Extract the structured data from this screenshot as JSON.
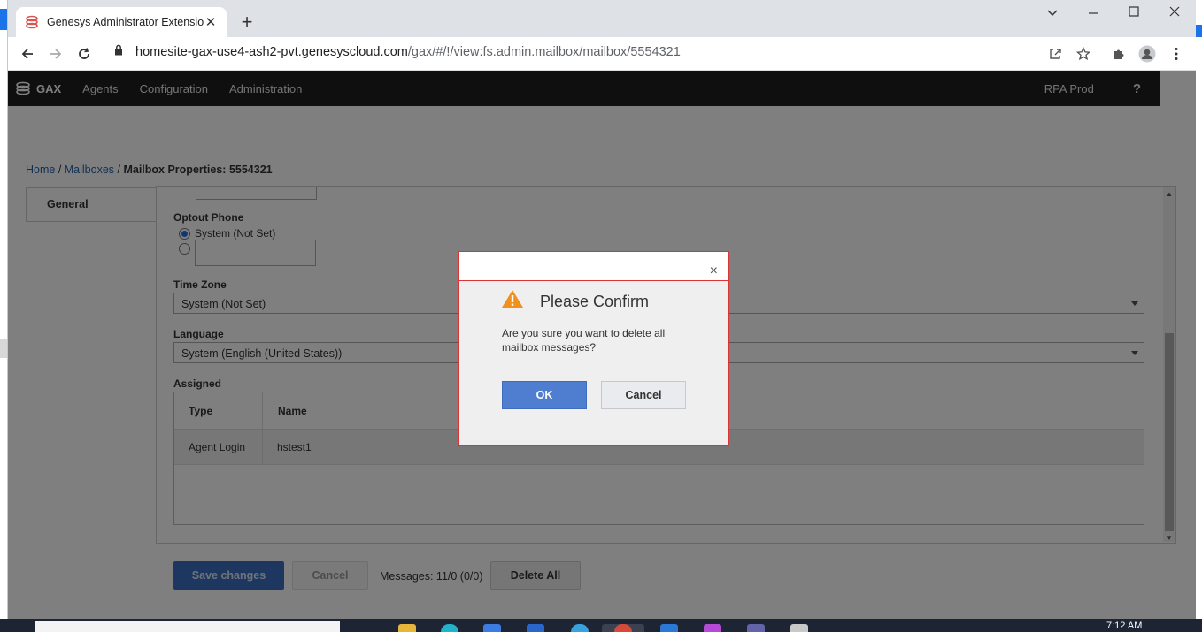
{
  "browser": {
    "tab_title": "Genesys Administrator Extension",
    "url_host": "homesite-gax-use4-ash2-pvt.genesyscloud.com",
    "url_path": "/gax/#/!/view:fs.admin.mailbox/mailbox/5554321"
  },
  "appnav": {
    "brand": "GAX",
    "items": [
      "Agents",
      "Configuration",
      "Administration"
    ],
    "environment": "RPA Prod",
    "help": "?"
  },
  "breadcrumb": {
    "home": "Home",
    "sep1": " / ",
    "mailboxes": "Mailboxes",
    "sep2": " / ",
    "current": "Mailbox Properties: 5554321"
  },
  "sidetab": {
    "general": "General"
  },
  "form": {
    "optout_label": "Optout Phone",
    "optout_system": "System (Not Set)",
    "timezone_label": "Time Zone",
    "timezone_value": "System (Not Set)",
    "language_label": "Language",
    "language_value": "System (English (United States))",
    "assigned_label": "Assigned",
    "table": {
      "headers": [
        "Type",
        "Name"
      ],
      "rows": [
        {
          "type": "Agent Login",
          "name": "hstest1"
        }
      ]
    }
  },
  "footer": {
    "save": "Save changes",
    "cancel": "Cancel",
    "messages": "Messages: 11/0 (0/0)",
    "delete_all": "Delete All"
  },
  "dialog": {
    "title": "Please Confirm",
    "message": "Are you sure you want to delete all mailbox messages?",
    "ok": "OK",
    "cancel": "Cancel",
    "close": "×"
  },
  "taskbar": {
    "clock": "7:12 AM"
  },
  "colors": {
    "nav_bg": "#1e1f21",
    "link": "#2660a4",
    "primary_button": "#4f7ed0",
    "warning": "#f0901e",
    "dialog_border": "#dd3333"
  }
}
